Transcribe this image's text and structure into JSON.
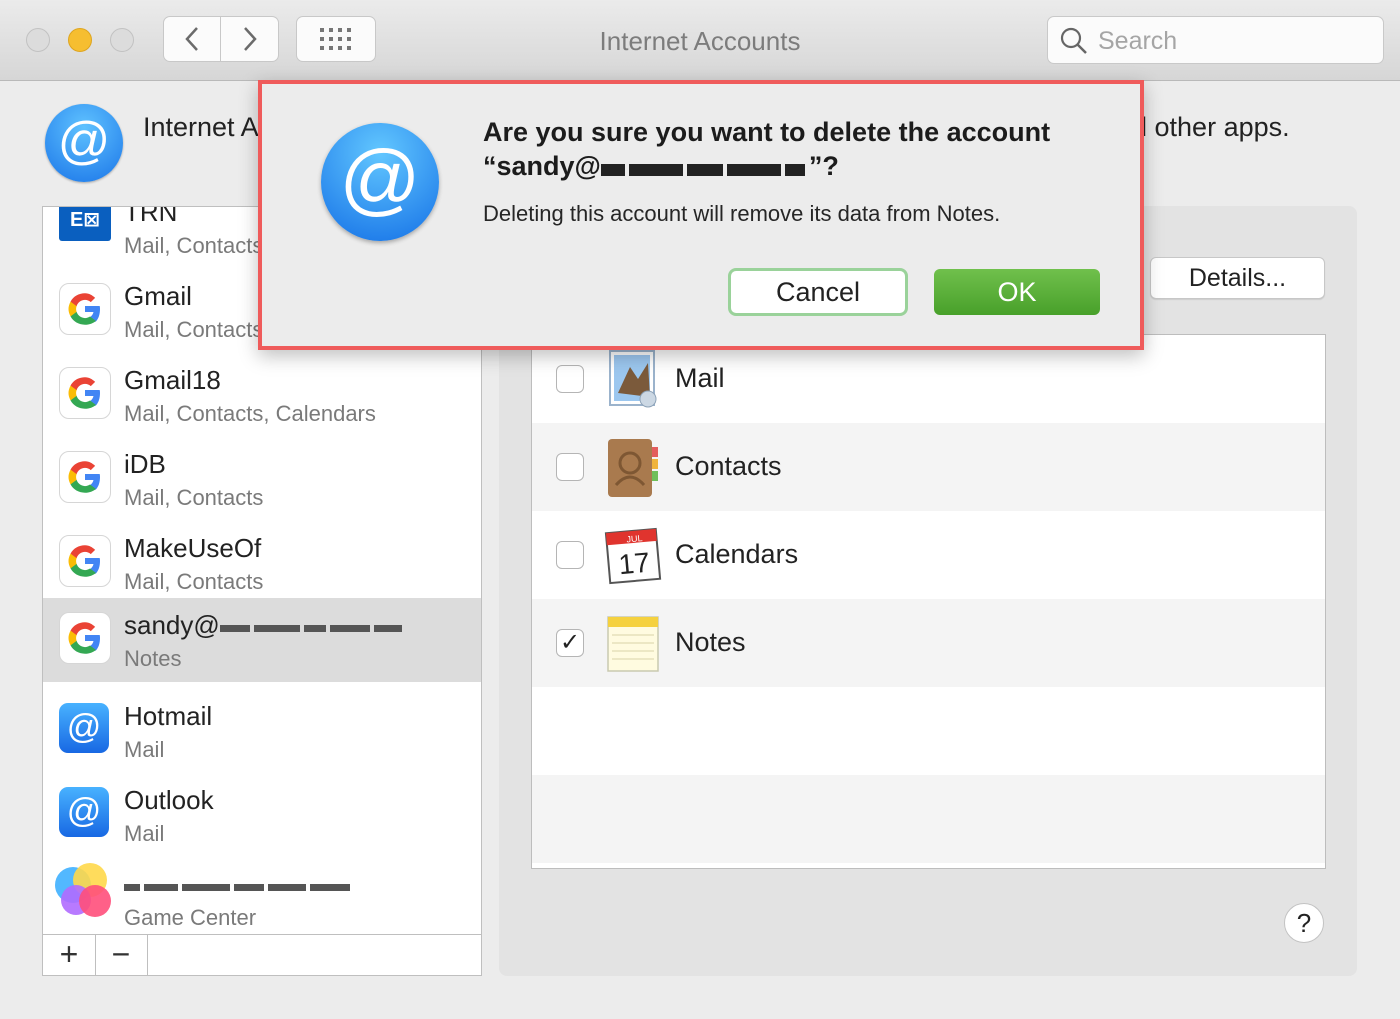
{
  "window": {
    "title": "Internet Accounts"
  },
  "search": {
    "placeholder": "Search"
  },
  "header": {
    "text": "Internet Accounts uses your accounts with Mail, Contacts, Calendar, Messages, and other apps."
  },
  "accounts": [
    {
      "name": "TRN",
      "services": "Mail, Contacts",
      "icon": "exchange-icon"
    },
    {
      "name": "Gmail",
      "services": "Mail, Contacts",
      "icon": "google-icon"
    },
    {
      "name": "Gmail18",
      "services": "Mail, Contacts, Calendars",
      "icon": "google-icon"
    },
    {
      "name": "iDB",
      "services": "Mail, Contacts",
      "icon": "google-icon"
    },
    {
      "name": "MakeUseOf",
      "services": "Mail, Contacts",
      "icon": "google-icon"
    },
    {
      "name": "sandy@",
      "services": "Notes",
      "icon": "google-icon",
      "selected": true
    },
    {
      "name": "Hotmail",
      "services": "Mail",
      "icon": "at-icon"
    },
    {
      "name": "Outlook",
      "services": "Mail",
      "icon": "at-icon"
    },
    {
      "name": "",
      "services": "Game Center",
      "icon": "game-center-icon"
    }
  ],
  "list_bar": {
    "add_label": "+",
    "remove_label": "−"
  },
  "details_button": "Details...",
  "apps": [
    {
      "label": "Mail",
      "checked": false,
      "icon": "mail-app-icon"
    },
    {
      "label": "Contacts",
      "checked": false,
      "icon": "contacts-app-icon"
    },
    {
      "label": "Calendars",
      "checked": false,
      "icon": "calendar-app-icon",
      "calendar_month": "JUL",
      "calendar_day": "17"
    },
    {
      "label": "Notes",
      "checked": true,
      "icon": "notes-app-icon"
    }
  ],
  "help_label": "?",
  "dialog": {
    "title": "Are you sure you want to delete the account “sandy@",
    "title_end": "”?",
    "message": "Deleting this account will remove its data from Notes.",
    "cancel_label": "Cancel",
    "ok_label": "OK",
    "highlight_color": "#ef5b5b"
  },
  "colors": {
    "ok_button": "#5cb23a",
    "at_icon": "#1a75e8"
  }
}
